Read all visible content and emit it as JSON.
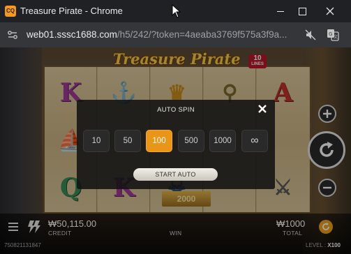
{
  "window": {
    "title": "Treasure Pirate - Chrome",
    "app_icon_text": "CQ",
    "controls": {
      "minimize": "minimize",
      "maximize": "maximize",
      "close": "close"
    }
  },
  "address_bar": {
    "url_host": "web01.sssc1688.com",
    "url_path": "/h5/242/?token=4aeaba3769f575a3f9a..."
  },
  "game": {
    "logo": "Treasure Pirate",
    "lines_number": "10",
    "lines_word": "LINES",
    "reels": [
      [
        "K",
        "ship-icon",
        "Q"
      ],
      [
        "anchor-icon",
        "",
        "K"
      ],
      [
        "treasure-icon",
        "",
        "pirate-icon"
      ],
      [
        "spyglass-icon",
        "",
        ""
      ],
      [
        "A",
        "",
        "swords-icon"
      ]
    ],
    "bonus_value": "2000",
    "side_buttons": {
      "plus": "increase-bet",
      "spin": "spin",
      "minus": "decrease-bet"
    }
  },
  "bottom_bar": {
    "credit_value": "₩50,115.00",
    "credit_label": "CREDIT",
    "win_label": "WIN",
    "total_value": "₩1000",
    "total_label": "TOTAL",
    "round_id": "750821131847",
    "level_label": "LEVEL :",
    "level_value": "X100"
  },
  "auto_spin": {
    "title": "AUTO SPIN",
    "options": [
      "10",
      "50",
      "100",
      "500",
      "1000",
      "∞"
    ],
    "selected": "100",
    "start_label": "START AUTO"
  },
  "colors": {
    "accent_orange": "#e99517",
    "logo_gold": "#f6d04d",
    "lines_red": "#b8172a"
  }
}
